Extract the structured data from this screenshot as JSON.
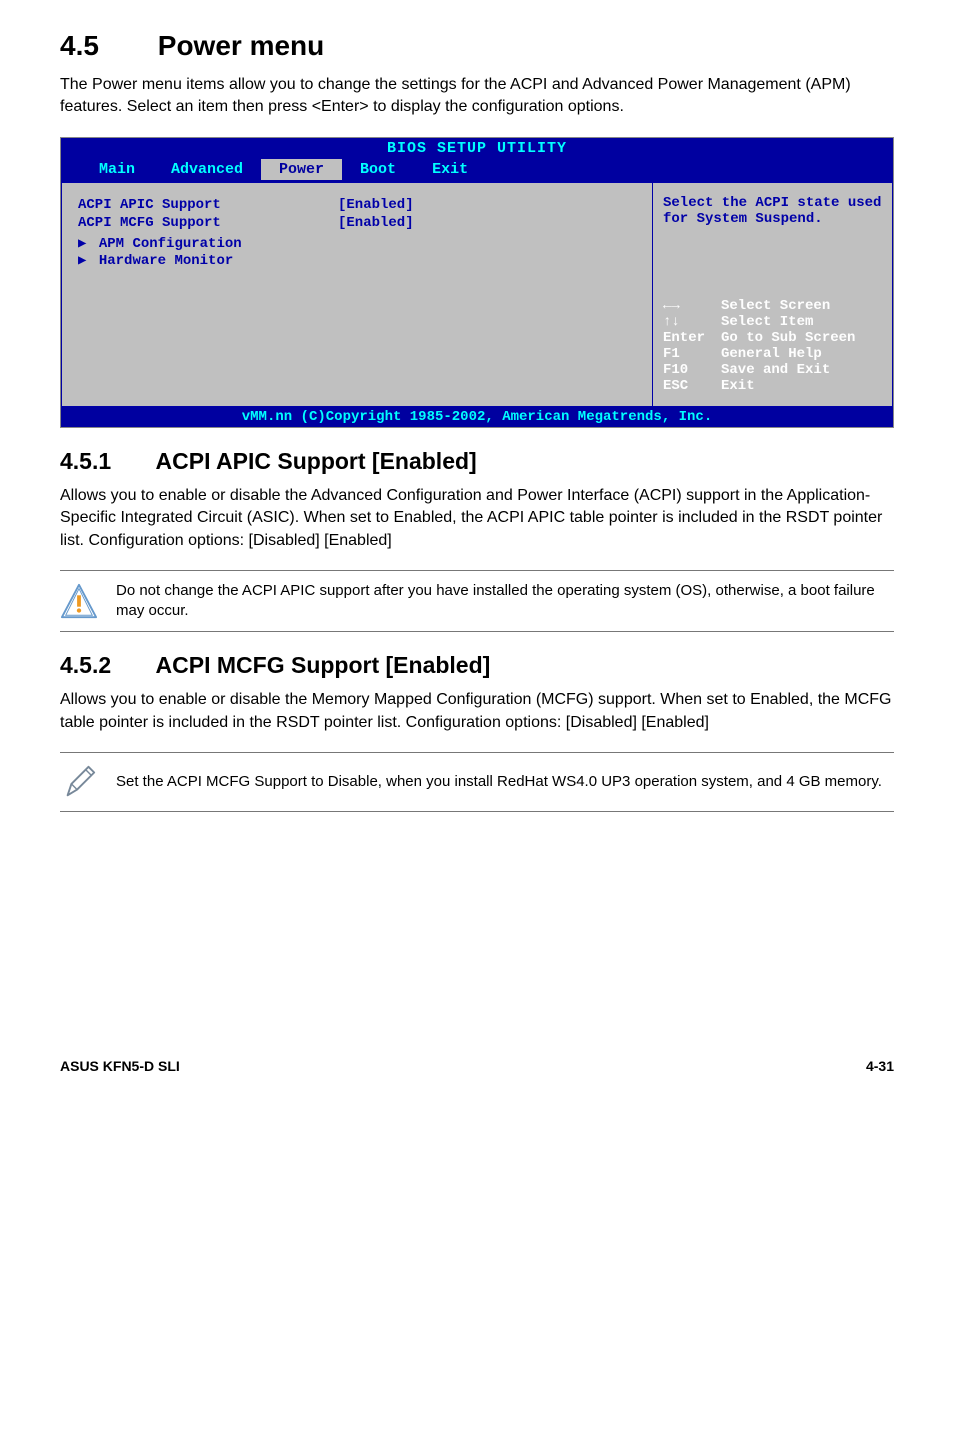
{
  "heading": {
    "num": "4.5",
    "title": "Power menu"
  },
  "intro": "The Power menu items allow you to change the settings for the ACPI and Advanced Power Management (APM) features. Select an item then press <Enter> to display the configuration options.",
  "bios": {
    "title": "BIOS SETUP UTILITY",
    "tabs": {
      "t1": "Main",
      "t2": "Advanced",
      "t3": "Power",
      "t4": "Boot",
      "t5": "Exit"
    },
    "rows": {
      "r1label": "ACPI APIC Support",
      "r1value": "[Enabled]",
      "r2label": "ACPI MCFG Support",
      "r2value": "[Enabled]"
    },
    "subs": {
      "s1": "APM Configuration",
      "s2": "Hardware Monitor"
    },
    "help": "Select the ACPI state used for System Suspend.",
    "legend": {
      "k1": "←→",
      "d1": "Select Screen",
      "k2": "↑↓",
      "d2": "Select Item",
      "k3": "Enter",
      "d3": "Go to Sub Screen",
      "k4": "F1",
      "d4": "General Help",
      "k5": "F10",
      "d5": "Save and Exit",
      "k6": "ESC",
      "d6": "Exit"
    },
    "footer": "vMM.nn (C)Copyright 1985-2002, American Megatrends, Inc."
  },
  "s451": {
    "num": "4.5.1",
    "title": "ACPI APIC Support [Enabled]",
    "body": "Allows you to enable or disable the Advanced Configuration and Power Interface (ACPI) support in the Application-Specific Integrated Circuit (ASIC). When set to Enabled, the ACPI APIC table pointer is included in the RSDT pointer list. Configuration options: [Disabled] [Enabled]",
    "callout": "Do not change the ACPI APIC support after you have installed the operating system (OS), otherwise, a boot failure may occur."
  },
  "s452": {
    "num": "4.5.2",
    "title": "ACPI MCFG Support [Enabled]",
    "body": "Allows you to enable or disable the Memory Mapped Configuration (MCFG) support. When set to Enabled, the MCFG table pointer is included in the RSDT pointer list. Configuration options: [Disabled] [Enabled]",
    "callout": "Set the ACPI MCFG Support to Disable, when you install RedHat WS4.0 UP3 operation system, and 4 GB memory."
  },
  "footer": {
    "left": "ASUS KFN5-D SLI",
    "right": "4-31"
  }
}
